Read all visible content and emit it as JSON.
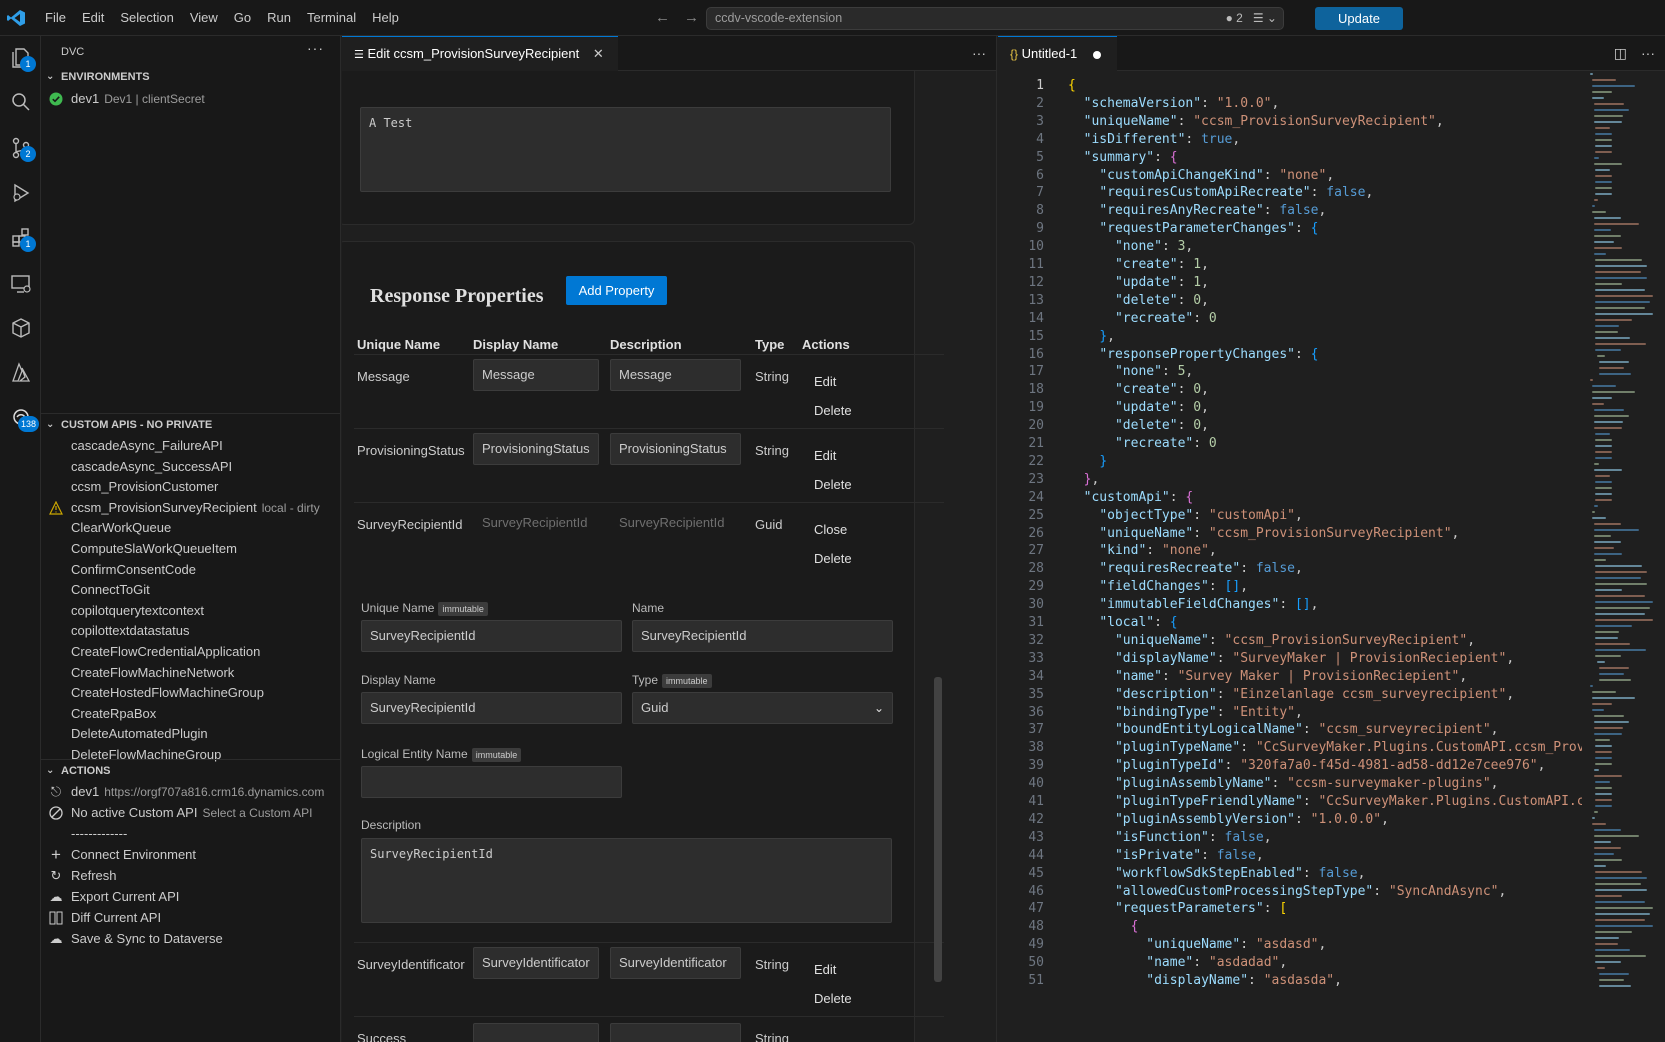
{
  "menu": [
    "File",
    "Edit",
    "Selection",
    "View",
    "Go",
    "Run",
    "Terminal",
    "Help"
  ],
  "command_center": {
    "text": "ccdv-vscode-extension",
    "count": "2"
  },
  "update_label": "Update",
  "activity_badges": {
    "explorer": "1",
    "scm": "2",
    "extensions": "1",
    "dvc": "138"
  },
  "sidebar": {
    "title": "DVC",
    "more": "···",
    "environments_header": "ENVIRONMENTS",
    "env_name": "dev1",
    "env_desc": "Dev1 | clientSecret",
    "custom_apis_header": "CUSTOM APIS - NO PRIVATE",
    "custom_apis": [
      {
        "label": "cascadeAsync_FailureAPI",
        "desc": ""
      },
      {
        "label": "cascadeAsync_SuccessAPI",
        "desc": ""
      },
      {
        "label": "ccsm_ProvisionCustomer",
        "desc": ""
      },
      {
        "label": "ccsm_ProvisionSurveyRecipient",
        "desc": "local - dirty"
      },
      {
        "label": "ClearWorkQueue",
        "desc": ""
      },
      {
        "label": "ComputeSlaWorkQueueItem",
        "desc": ""
      },
      {
        "label": "ConfirmConsentCode",
        "desc": ""
      },
      {
        "label": "ConnectToGit",
        "desc": ""
      },
      {
        "label": "copilotquerytextcontext",
        "desc": ""
      },
      {
        "label": "copilottextdatastatus",
        "desc": ""
      },
      {
        "label": "CreateFlowCredentialApplication",
        "desc": ""
      },
      {
        "label": "CreateFlowMachineNetwork",
        "desc": ""
      },
      {
        "label": "CreateHostedFlowMachineGroup",
        "desc": ""
      },
      {
        "label": "CreateRpaBox",
        "desc": ""
      },
      {
        "label": "DeleteAutomatedPlugin",
        "desc": ""
      },
      {
        "label": "DeleteFlowMachineGroup",
        "desc": ""
      }
    ],
    "actions_header": "ACTIONS",
    "actions": [
      {
        "label": "dev1",
        "desc": "https://orgf707a816.crm16.dynamics.com"
      },
      {
        "label": "No active Custom API",
        "desc": "Select a Custom API"
      },
      {
        "label": "-------------",
        "desc": ""
      },
      {
        "label": "Connect Environment",
        "desc": ""
      },
      {
        "label": "Refresh",
        "desc": ""
      },
      {
        "label": "Export Current API",
        "desc": ""
      },
      {
        "label": "Diff Current API",
        "desc": ""
      },
      {
        "label": "Save & Sync to Dataverse",
        "desc": ""
      }
    ]
  },
  "left_editor": {
    "tab_label": "Edit ccsm_ProvisionSurveyRecipient",
    "top_textarea": "A Test",
    "response_title": "Response Properties",
    "add_property": "Add Property",
    "columns": [
      "Unique Name",
      "Display Name",
      "Description",
      "Type",
      "Actions"
    ],
    "rows": [
      {
        "unique": "Message",
        "display": "Message",
        "description": "Message",
        "type": "String",
        "action1": "Edit",
        "action2": "Delete"
      },
      {
        "unique": "ProvisioningStatus",
        "display": "ProvisioningStatus",
        "description": "ProvisioningStatus",
        "type": "String",
        "action1": "Edit",
        "action2": "Delete"
      },
      {
        "unique": "SurveyRecipientId",
        "display": "SurveyRecipientId",
        "description": "SurveyRecipientId",
        "type": "Guid",
        "action1": "Close",
        "action2": "Delete"
      }
    ],
    "form": {
      "unique_name_label": "Unique Name",
      "immutable": "immutable",
      "unique_name_value": "SurveyRecipientId",
      "name_label": "Name",
      "name_value": "SurveyRecipientId",
      "display_name_label": "Display Name",
      "display_name_value": "SurveyRecipientId",
      "type_label": "Type",
      "type_value": "Guid",
      "logical_label": "Logical Entity Name",
      "logical_value": "",
      "description_label": "Description",
      "description_value": "SurveyRecipientId"
    },
    "row4": {
      "unique": "SurveyIdentificator",
      "display": "SurveyIdentificator",
      "description": "SurveyIdentificator",
      "type": "String",
      "action1": "Edit",
      "action2": "Delete"
    },
    "row5_partial": {
      "unique": "Success",
      "type": "String"
    }
  },
  "right_editor": {
    "tab_label": "Untitled-1",
    "code_lines": [
      [
        [
          "p1",
          "{"
        ]
      ],
      [
        [
          "t",
          "  "
        ],
        [
          "k",
          "\"schemaVersion\""
        ],
        [
          "t",
          ": "
        ],
        [
          "s",
          "\"1.0.0\""
        ],
        [
          "t",
          ","
        ]
      ],
      [
        [
          "t",
          "  "
        ],
        [
          "k",
          "\"uniqueName\""
        ],
        [
          "t",
          ": "
        ],
        [
          "s",
          "\"ccsm_ProvisionSurveyRecipient\""
        ],
        [
          "t",
          ","
        ]
      ],
      [
        [
          "t",
          "  "
        ],
        [
          "k",
          "\"isDifferent\""
        ],
        [
          "t",
          ": "
        ],
        [
          "b",
          "true"
        ],
        [
          "t",
          ","
        ]
      ],
      [
        [
          "t",
          "  "
        ],
        [
          "k",
          "\"summary\""
        ],
        [
          "t",
          ": "
        ],
        [
          "p2",
          "{"
        ]
      ],
      [
        [
          "t",
          "    "
        ],
        [
          "k",
          "\"customApiChangeKind\""
        ],
        [
          "t",
          ": "
        ],
        [
          "s",
          "\"none\""
        ],
        [
          "t",
          ","
        ]
      ],
      [
        [
          "t",
          "    "
        ],
        [
          "k",
          "\"requiresCustomApiRecreate\""
        ],
        [
          "t",
          ": "
        ],
        [
          "b",
          "false"
        ],
        [
          "t",
          ","
        ]
      ],
      [
        [
          "t",
          "    "
        ],
        [
          "k",
          "\"requiresAnyRecreate\""
        ],
        [
          "t",
          ": "
        ],
        [
          "b",
          "false"
        ],
        [
          "t",
          ","
        ]
      ],
      [
        [
          "t",
          "    "
        ],
        [
          "k",
          "\"requestParameterChanges\""
        ],
        [
          "t",
          ": "
        ],
        [
          "p3",
          "{"
        ]
      ],
      [
        [
          "t",
          "      "
        ],
        [
          "k",
          "\"none\""
        ],
        [
          "t",
          ": "
        ],
        [
          "n",
          "3"
        ],
        [
          "t",
          ","
        ]
      ],
      [
        [
          "t",
          "      "
        ],
        [
          "k",
          "\"create\""
        ],
        [
          "t",
          ": "
        ],
        [
          "n",
          "1"
        ],
        [
          "t",
          ","
        ]
      ],
      [
        [
          "t",
          "      "
        ],
        [
          "k",
          "\"update\""
        ],
        [
          "t",
          ": "
        ],
        [
          "n",
          "1"
        ],
        [
          "t",
          ","
        ]
      ],
      [
        [
          "t",
          "      "
        ],
        [
          "k",
          "\"delete\""
        ],
        [
          "t",
          ": "
        ],
        [
          "n",
          "0"
        ],
        [
          "t",
          ","
        ]
      ],
      [
        [
          "t",
          "      "
        ],
        [
          "k",
          "\"recreate\""
        ],
        [
          "t",
          ": "
        ],
        [
          "n",
          "0"
        ]
      ],
      [
        [
          "t",
          "    "
        ],
        [
          "p3",
          "}"
        ],
        [
          "t",
          ","
        ]
      ],
      [
        [
          "t",
          "    "
        ],
        [
          "k",
          "\"responsePropertyChanges\""
        ],
        [
          "t",
          ": "
        ],
        [
          "p3",
          "{"
        ]
      ],
      [
        [
          "t",
          "      "
        ],
        [
          "k",
          "\"none\""
        ],
        [
          "t",
          ": "
        ],
        [
          "n",
          "5"
        ],
        [
          "t",
          ","
        ]
      ],
      [
        [
          "t",
          "      "
        ],
        [
          "k",
          "\"create\""
        ],
        [
          "t",
          ": "
        ],
        [
          "n",
          "0"
        ],
        [
          "t",
          ","
        ]
      ],
      [
        [
          "t",
          "      "
        ],
        [
          "k",
          "\"update\""
        ],
        [
          "t",
          ": "
        ],
        [
          "n",
          "0"
        ],
        [
          "t",
          ","
        ]
      ],
      [
        [
          "t",
          "      "
        ],
        [
          "k",
          "\"delete\""
        ],
        [
          "t",
          ": "
        ],
        [
          "n",
          "0"
        ],
        [
          "t",
          ","
        ]
      ],
      [
        [
          "t",
          "      "
        ],
        [
          "k",
          "\"recreate\""
        ],
        [
          "t",
          ": "
        ],
        [
          "n",
          "0"
        ]
      ],
      [
        [
          "t",
          "    "
        ],
        [
          "p3",
          "}"
        ]
      ],
      [
        [
          "t",
          "  "
        ],
        [
          "p2",
          "}"
        ],
        [
          "t",
          ","
        ]
      ],
      [
        [
          "t",
          "  "
        ],
        [
          "k",
          "\"customApi\""
        ],
        [
          "t",
          ": "
        ],
        [
          "p2",
          "{"
        ]
      ],
      [
        [
          "t",
          "    "
        ],
        [
          "k",
          "\"objectType\""
        ],
        [
          "t",
          ": "
        ],
        [
          "s",
          "\"customApi\""
        ],
        [
          "t",
          ","
        ]
      ],
      [
        [
          "t",
          "    "
        ],
        [
          "k",
          "\"uniqueName\""
        ],
        [
          "t",
          ": "
        ],
        [
          "s",
          "\"ccsm_ProvisionSurveyRecipient\""
        ],
        [
          "t",
          ","
        ]
      ],
      [
        [
          "t",
          "    "
        ],
        [
          "k",
          "\"kind\""
        ],
        [
          "t",
          ": "
        ],
        [
          "s",
          "\"none\""
        ],
        [
          "t",
          ","
        ]
      ],
      [
        [
          "t",
          "    "
        ],
        [
          "k",
          "\"requiresRecreate\""
        ],
        [
          "t",
          ": "
        ],
        [
          "b",
          "false"
        ],
        [
          "t",
          ","
        ]
      ],
      [
        [
          "t",
          "    "
        ],
        [
          "k",
          "\"fieldChanges\""
        ],
        [
          "t",
          ": "
        ],
        [
          "p3",
          "[]"
        ],
        [
          "t",
          ","
        ]
      ],
      [
        [
          "t",
          "    "
        ],
        [
          "k",
          "\"immutableFieldChanges\""
        ],
        [
          "t",
          ": "
        ],
        [
          "p3",
          "[]"
        ],
        [
          "t",
          ","
        ]
      ],
      [
        [
          "t",
          "    "
        ],
        [
          "k",
          "\"local\""
        ],
        [
          "t",
          ": "
        ],
        [
          "p3",
          "{"
        ]
      ],
      [
        [
          "t",
          "      "
        ],
        [
          "k",
          "\"uniqueName\""
        ],
        [
          "t",
          ": "
        ],
        [
          "s",
          "\"ccsm_ProvisionSurveyRecipient\""
        ],
        [
          "t",
          ","
        ]
      ],
      [
        [
          "t",
          "      "
        ],
        [
          "k",
          "\"displayName\""
        ],
        [
          "t",
          ": "
        ],
        [
          "s",
          "\"SurveyMaker | ProvisionReciepient\""
        ],
        [
          "t",
          ","
        ]
      ],
      [
        [
          "t",
          "      "
        ],
        [
          "k",
          "\"name\""
        ],
        [
          "t",
          ": "
        ],
        [
          "s",
          "\"Survey Maker | ProvisionReciepient\""
        ],
        [
          "t",
          ","
        ]
      ],
      [
        [
          "t",
          "      "
        ],
        [
          "k",
          "\"description\""
        ],
        [
          "t",
          ": "
        ],
        [
          "s",
          "\"Einzelanlage ccsm_surveyrecipient\""
        ],
        [
          "t",
          ","
        ]
      ],
      [
        [
          "t",
          "      "
        ],
        [
          "k",
          "\"bindingType\""
        ],
        [
          "t",
          ": "
        ],
        [
          "s",
          "\"Entity\""
        ],
        [
          "t",
          ","
        ]
      ],
      [
        [
          "t",
          "      "
        ],
        [
          "k",
          "\"boundEntityLogicalName\""
        ],
        [
          "t",
          ": "
        ],
        [
          "s",
          "\"ccsm_surveyrecipient\""
        ],
        [
          "t",
          ","
        ]
      ],
      [
        [
          "t",
          "      "
        ],
        [
          "k",
          "\"pluginTypeName\""
        ],
        [
          "t",
          ": "
        ],
        [
          "s",
          "\"CcSurveyMaker.Plugins.CustomAPI.ccsm_ProvisionSurve"
        ]
      ],
      [
        [
          "t",
          "      "
        ],
        [
          "k",
          "\"pluginTypeId\""
        ],
        [
          "t",
          ": "
        ],
        [
          "s",
          "\"320fa7a0-f45d-4981-ad58-dd12e7cee976\""
        ],
        [
          "t",
          ","
        ]
      ],
      [
        [
          "t",
          "      "
        ],
        [
          "k",
          "\"pluginAssemblyName\""
        ],
        [
          "t",
          ": "
        ],
        [
          "s",
          "\"ccsm-surveymaker-plugins\""
        ],
        [
          "t",
          ","
        ]
      ],
      [
        [
          "t",
          "      "
        ],
        [
          "k",
          "\"pluginTypeFriendlyName\""
        ],
        [
          "t",
          ": "
        ],
        [
          "s",
          "\"CcSurveyMaker.Plugins.CustomAPI.ccsm_Provisi"
        ]
      ],
      [
        [
          "t",
          "      "
        ],
        [
          "k",
          "\"pluginAssemblyVersion\""
        ],
        [
          "t",
          ": "
        ],
        [
          "s",
          "\"1.0.0.0\""
        ],
        [
          "t",
          ","
        ]
      ],
      [
        [
          "t",
          "      "
        ],
        [
          "k",
          "\"isFunction\""
        ],
        [
          "t",
          ": "
        ],
        [
          "b",
          "false"
        ],
        [
          "t",
          ","
        ]
      ],
      [
        [
          "t",
          "      "
        ],
        [
          "k",
          "\"isPrivate\""
        ],
        [
          "t",
          ": "
        ],
        [
          "b",
          "false"
        ],
        [
          "t",
          ","
        ]
      ],
      [
        [
          "t",
          "      "
        ],
        [
          "k",
          "\"workflowSdkStepEnabled\""
        ],
        [
          "t",
          ": "
        ],
        [
          "b",
          "false"
        ],
        [
          "t",
          ","
        ]
      ],
      [
        [
          "t",
          "      "
        ],
        [
          "k",
          "\"allowedCustomProcessingStepType\""
        ],
        [
          "t",
          ": "
        ],
        [
          "s",
          "\"SyncAndAsync\""
        ],
        [
          "t",
          ","
        ]
      ],
      [
        [
          "t",
          "      "
        ],
        [
          "k",
          "\"requestParameters\""
        ],
        [
          "t",
          ": "
        ],
        [
          "p1",
          "["
        ]
      ],
      [
        [
          "t",
          "        "
        ],
        [
          "p2",
          "{"
        ]
      ],
      [
        [
          "t",
          "          "
        ],
        [
          "k",
          "\"uniqueName\""
        ],
        [
          "t",
          ": "
        ],
        [
          "s",
          "\"asdasd\""
        ],
        [
          "t",
          ","
        ]
      ],
      [
        [
          "t",
          "          "
        ],
        [
          "k",
          "\"name\""
        ],
        [
          "t",
          ": "
        ],
        [
          "s",
          "\"asdadad\""
        ],
        [
          "t",
          ","
        ]
      ],
      [
        [
          "t",
          "          "
        ],
        [
          "k",
          "\"displayName\""
        ],
        [
          "t",
          ": "
        ],
        [
          "s",
          "\"asdasda\""
        ],
        [
          "t",
          ","
        ]
      ]
    ]
  }
}
